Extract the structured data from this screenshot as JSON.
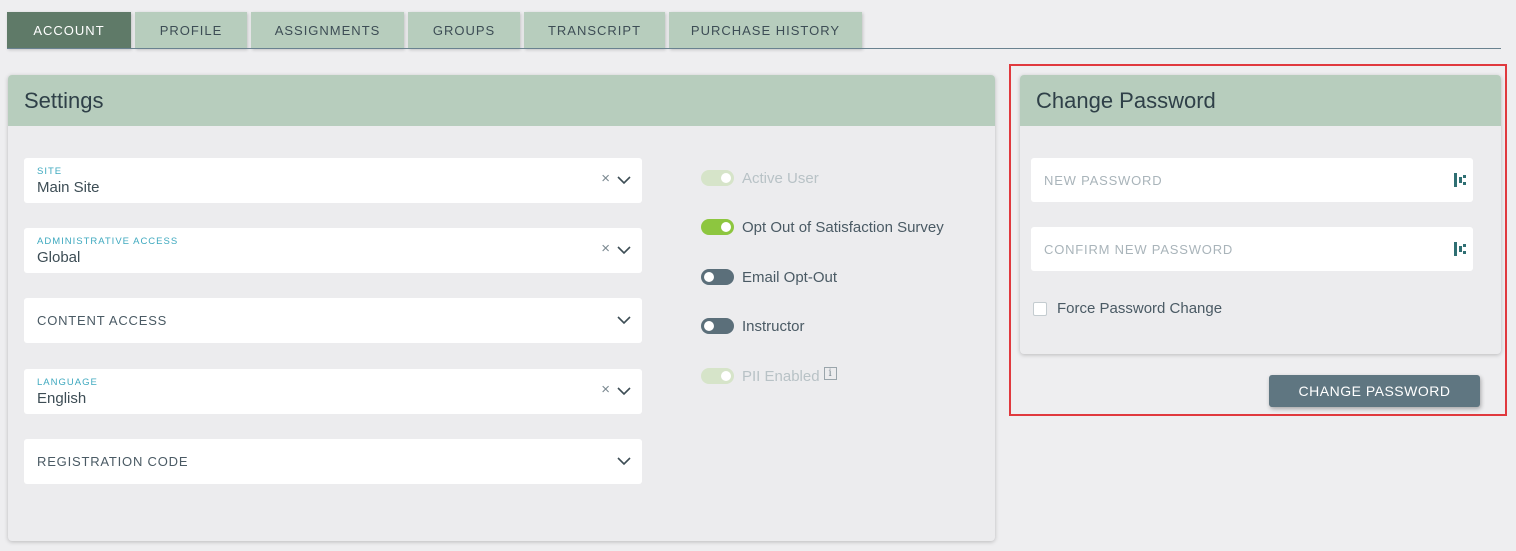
{
  "tabs": [
    {
      "label": "ACCOUNT",
      "active": true
    },
    {
      "label": "PROFILE"
    },
    {
      "label": "ASSIGNMENTS"
    },
    {
      "label": "GROUPS"
    },
    {
      "label": "TRANSCRIPT"
    },
    {
      "label": "PURCHASE HISTORY"
    }
  ],
  "settings": {
    "title": "Settings",
    "fields": [
      {
        "label": "SITE",
        "value": "Main Site"
      },
      {
        "label": "ADMINISTRATIVE ACCESS",
        "value": "Global"
      },
      {
        "placeholder": "CONTENT ACCESS"
      },
      {
        "label": "LANGUAGE",
        "value": "English"
      },
      {
        "placeholder": "REGISTRATION CODE"
      }
    ],
    "clear_icon": "×",
    "toggles": [
      {
        "label": "Active User",
        "state": "on",
        "disabled": true
      },
      {
        "label": "Opt Out of Satisfaction Survey",
        "state": "on",
        "disabled": false
      },
      {
        "label": "Email Opt-Out",
        "state": "off",
        "disabled": false
      },
      {
        "label": "Instructor",
        "state": "off",
        "disabled": false
      },
      {
        "label": "PII Enabled",
        "state": "on",
        "disabled": true
      }
    ],
    "info_icon": "i"
  },
  "change_password": {
    "title": "Change Password",
    "new_password_placeholder": "NEW PASSWORD",
    "confirm_password_placeholder": "CONFIRM NEW PASSWORD",
    "force_change_label": "Force Password Change",
    "button_label": "CHANGE PASSWORD"
  },
  "colors": {
    "tab_bg": "#b7cdbd",
    "tab_active_bg": "#5f7a68",
    "toggle_on": "#8dc63f",
    "toggle_off": "#5b6f7a",
    "highlight": "#e0393e",
    "button_bg": "#5f7681"
  }
}
